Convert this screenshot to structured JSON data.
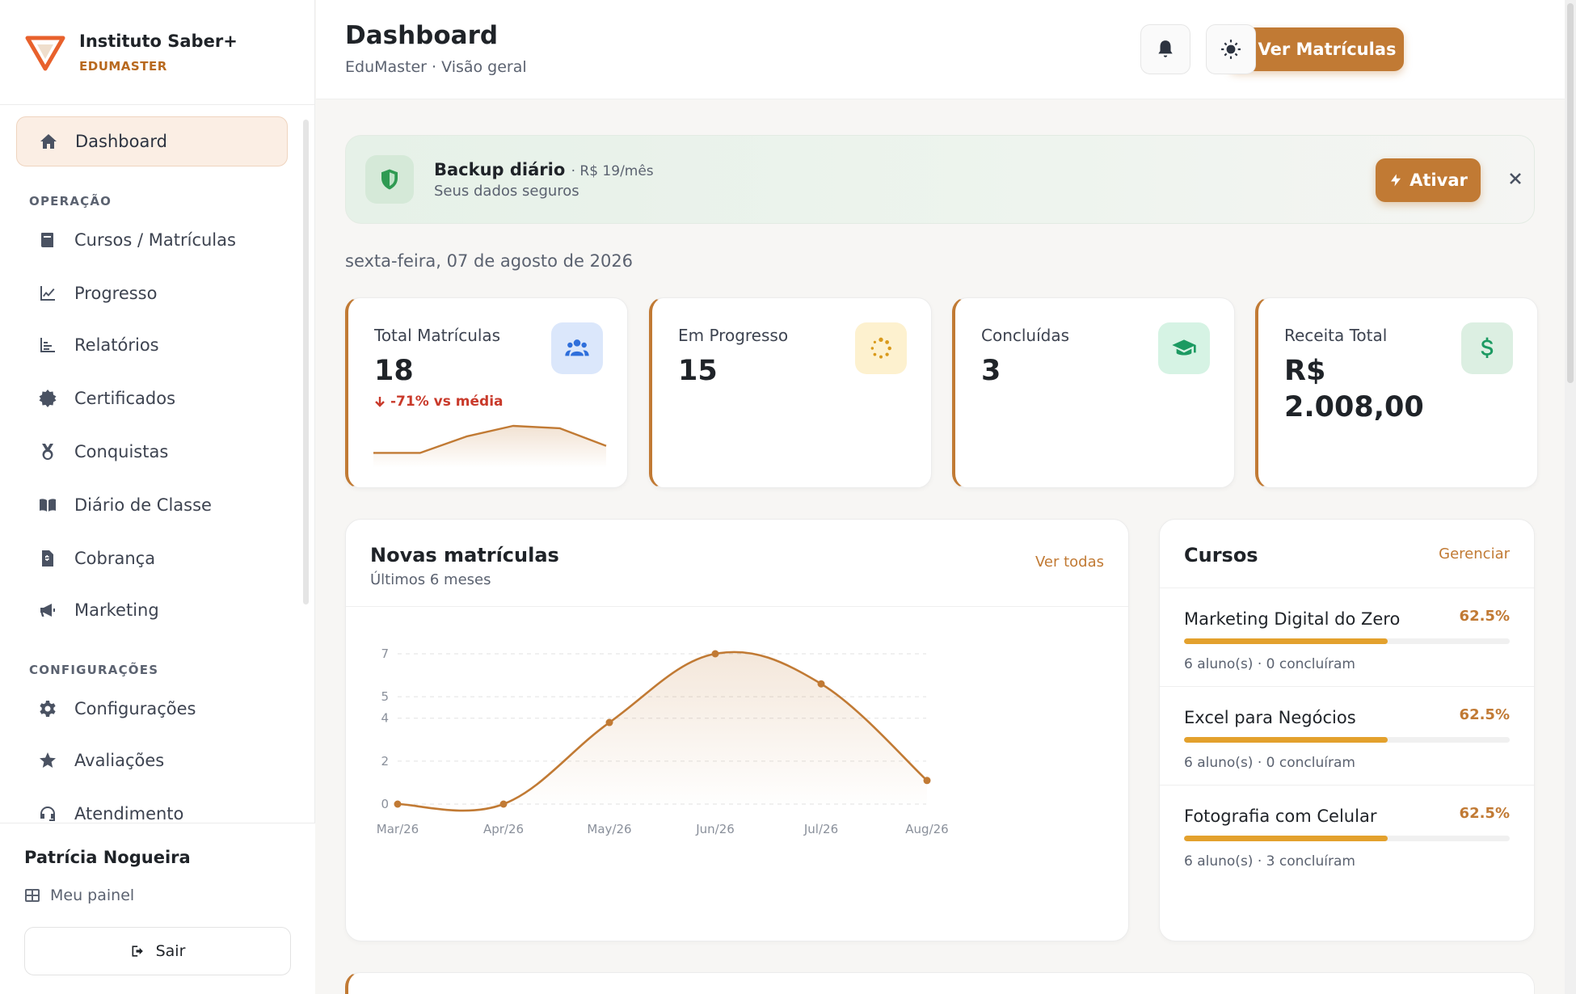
{
  "brand": {
    "name": "Instituto Saber+",
    "subtitle": "EDUMASTER"
  },
  "sidebar": {
    "items": [
      {
        "label": "Dashboard",
        "icon": "home-icon"
      },
      {
        "label": "Cursos / Matrículas",
        "icon": "book-icon"
      },
      {
        "label": "Progresso",
        "icon": "line-chart-icon"
      },
      {
        "label": "Relatórios",
        "icon": "bar-chart-icon"
      },
      {
        "label": "Certificados",
        "icon": "certificate-icon"
      },
      {
        "label": "Conquistas",
        "icon": "medal-icon"
      },
      {
        "label": "Diário de Classe",
        "icon": "open-book-icon"
      },
      {
        "label": "Cobrança",
        "icon": "invoice-icon"
      },
      {
        "label": "Marketing",
        "icon": "megaphone-icon"
      },
      {
        "label": "Configurações",
        "icon": "gear-icon"
      },
      {
        "label": "Avaliações",
        "icon": "star-icon"
      },
      {
        "label": "Atendimento",
        "icon": "headset-icon"
      }
    ],
    "sections": {
      "operacao": "OPERAÇÃO",
      "configuracoes": "CONFIGURAÇÕES"
    },
    "user_name": "Patrícia Nogueira",
    "my_panel": "Meu painel",
    "logout": "Sair"
  },
  "header": {
    "title": "Dashboard",
    "subtitle": "EduMaster · Visão geral",
    "primary_button": "Ver Matrículas"
  },
  "banner": {
    "title": "Backup diário",
    "price": "· R$ 19/mês",
    "subtitle": "Seus dados seguros",
    "button": "Ativar"
  },
  "date_line": "sexta-feira, 07 de agosto de 2026",
  "stats": [
    {
      "label": "Total Matrículas",
      "value": "18",
      "delta": "-71% vs média",
      "icon": "users-icon",
      "icon_bg": "#dbe7fb",
      "icon_color": "#2f6fdb"
    },
    {
      "label": "Em Progresso",
      "value": "15",
      "icon": "spinner-icon",
      "icon_bg": "#fdf1cf",
      "icon_color": "#d99a1b"
    },
    {
      "label": "Concluídas",
      "value": "3",
      "icon": "graduation-cap-icon",
      "icon_bg": "#d6f3e4",
      "icon_color": "#1c9a62"
    },
    {
      "label": "Receita Total",
      "value": "R$ 2.008,00",
      "icon": "dollar-icon",
      "icon_bg": "#dcefe2",
      "icon_color": "#1c9a62"
    }
  ],
  "enrollments_panel": {
    "title": "Novas matrículas",
    "subtitle": "Últimos 6 meses",
    "link": "Ver todas"
  },
  "chart_data": {
    "type": "area",
    "categories": [
      "Mar/26",
      "Apr/26",
      "May/26",
      "Jun/26",
      "Jul/26",
      "Aug/26"
    ],
    "series": [
      {
        "values": [
          0,
          0,
          3.8,
          7,
          5.6,
          1.1
        ]
      }
    ],
    "yticks": [
      0,
      2,
      4,
      5,
      7
    ],
    "ylim": [
      0,
      7
    ],
    "grid": true,
    "color": "#c17a34"
  },
  "sparkline_data": {
    "values": [
      1,
      1,
      2.4,
      3.3,
      3.1,
      1.6
    ]
  },
  "courses_panel": {
    "title": "Cursos",
    "link": "Gerenciar",
    "courses": [
      {
        "name": "Marketing Digital do Zero",
        "pct": "62.5%",
        "progress": 0.625,
        "meta": "6 aluno(s) · 0 concluíram"
      },
      {
        "name": "Excel para Negócios",
        "pct": "62.5%",
        "progress": 0.625,
        "meta": "6 aluno(s) · 0 concluíram"
      },
      {
        "name": "Fotografia com Celular",
        "pct": "62.5%",
        "progress": 0.625,
        "meta": "6 aluno(s) · 3 concluíram"
      }
    ]
  },
  "colors": {
    "accent": "#c17a34",
    "danger": "#c93a2b",
    "progress": "#e3a12d"
  }
}
